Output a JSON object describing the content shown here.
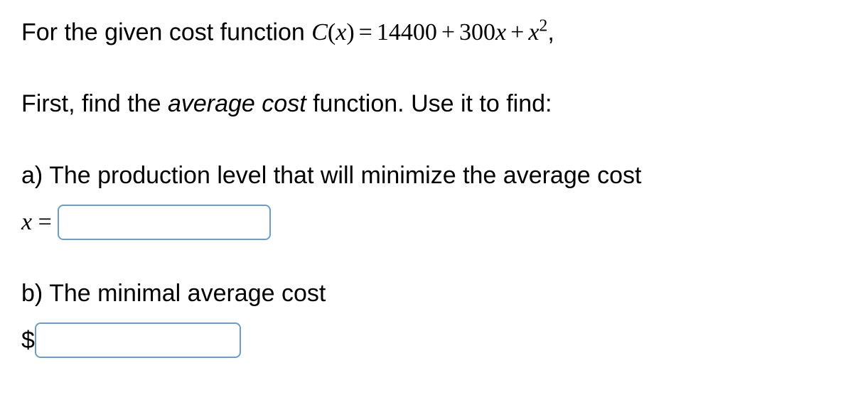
{
  "intro": {
    "prefix": "For the given cost function ",
    "fn": "C",
    "var": "x",
    "eq_text": "=",
    "const": "14400",
    "coef1": "300",
    "exp": "2",
    "suffix": ","
  },
  "instruction": {
    "part1": "First, find the ",
    "italic": "average cost",
    "part2": " function. Use it to find:"
  },
  "partA": {
    "label": "a) The production level that will minimize the average cost",
    "var_label_x": "x",
    "var_label_eq": " ="
  },
  "partB": {
    "label": "b) The minimal average cost",
    "currency": "$"
  },
  "inputs": {
    "a_value": "",
    "b_value": ""
  }
}
